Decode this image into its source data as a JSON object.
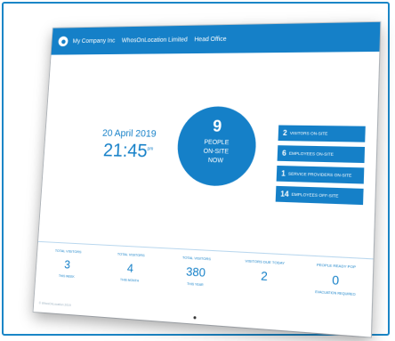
{
  "topbar": {
    "items": [
      "My Company Inc",
      "WhosOnLocation Limited",
      "Head Office"
    ]
  },
  "main": {
    "date": "20 April 2019",
    "time": "21:45",
    "time_suffix": "pm",
    "people": {
      "count": "9",
      "label_lines": [
        "PEOPLE",
        "ON-SITE",
        "NOW"
      ]
    }
  },
  "stats": [
    {
      "num": "2",
      "label": "VISITORS ON-SITE"
    },
    {
      "num": "6",
      "label": "EMPLOYEES ON-SITE"
    },
    {
      "num": "1",
      "label": "SERVICE PROVIDERS ON-SITE"
    },
    {
      "num": "14",
      "label": "EMPLOYEES OFF-SITE"
    }
  ],
  "bottom": [
    {
      "title": "TOTAL VISITORS",
      "value": "3",
      "sub": "THIS WEEK"
    },
    {
      "title": "TOTAL VISITORS",
      "value": "4",
      "sub": "THIS MONTH"
    },
    {
      "title": "TOTAL VISITORS",
      "value": "380",
      "sub": "THIS YEAR"
    },
    {
      "title": "VISITORS DUE TODAY",
      "value": "2",
      "sub": ""
    },
    {
      "title": "PEOPLE READY POP",
      "value": "0",
      "sub": "EVACUATION REQUIRED"
    }
  ],
  "footer": "© WhosOnLocation 2019"
}
